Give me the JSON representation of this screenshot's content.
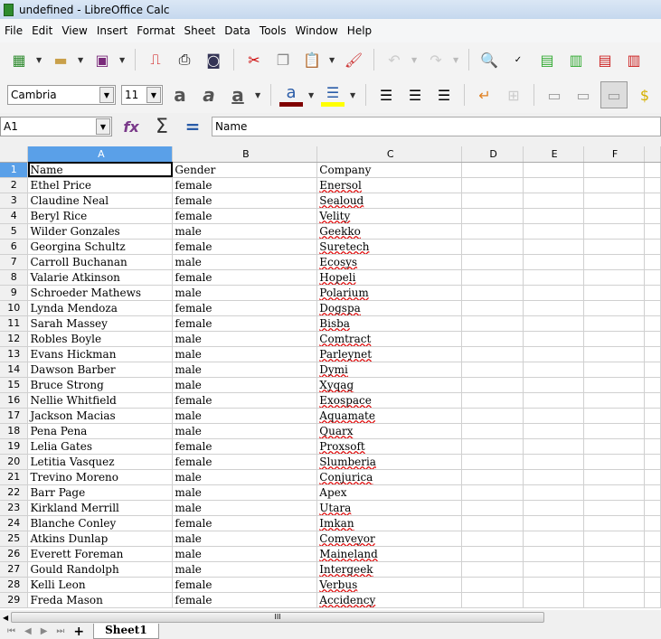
{
  "window": {
    "title": "undefined - LibreOffice Calc"
  },
  "menu": [
    "File",
    "Edit",
    "View",
    "Insert",
    "Format",
    "Sheet",
    "Data",
    "Tools",
    "Window",
    "Help"
  ],
  "font": {
    "name": "Cambria",
    "size": "11"
  },
  "namebox": "A1",
  "formula": "Name",
  "columns": [
    "A",
    "B",
    "C",
    "D",
    "E",
    "F"
  ],
  "header": {
    "name": "Name",
    "gender": "Gender",
    "company": "Company"
  },
  "rows": [
    {
      "name": "Ethel Price",
      "gender": "female",
      "company": "Enersol"
    },
    {
      "name": "Claudine Neal",
      "gender": "female",
      "company": "Sealoud"
    },
    {
      "name": "Beryl Rice",
      "gender": "female",
      "company": "Velity"
    },
    {
      "name": "Wilder Gonzales",
      "gender": "male",
      "company": "Geekko"
    },
    {
      "name": "Georgina Schultz",
      "gender": "female",
      "company": "Suretech"
    },
    {
      "name": "Carroll Buchanan",
      "gender": "male",
      "company": "Ecosys"
    },
    {
      "name": "Valarie Atkinson",
      "gender": "female",
      "company": "Hopeli"
    },
    {
      "name": "Schroeder Mathews",
      "gender": "male",
      "company": "Polarium"
    },
    {
      "name": "Lynda Mendoza",
      "gender": "female",
      "company": "Dogspa"
    },
    {
      "name": "Sarah Massey",
      "gender": "female",
      "company": "Bisba"
    },
    {
      "name": "Robles Boyle",
      "gender": "male",
      "company": "Comtract"
    },
    {
      "name": "Evans Hickman",
      "gender": "male",
      "company": "Parleynet"
    },
    {
      "name": "Dawson Barber",
      "gender": "male",
      "company": "Dymi"
    },
    {
      "name": "Bruce Strong",
      "gender": "male",
      "company": "Xyqag"
    },
    {
      "name": "Nellie Whitfield",
      "gender": "female",
      "company": "Exospace"
    },
    {
      "name": "Jackson Macias",
      "gender": "male",
      "company": "Aquamate"
    },
    {
      "name": "Pena Pena",
      "gender": "male",
      "company": "Quarx"
    },
    {
      "name": "Lelia Gates",
      "gender": "female",
      "company": "Proxsoft"
    },
    {
      "name": "Letitia Vasquez",
      "gender": "female",
      "company": "Slumberia"
    },
    {
      "name": "Trevino Moreno",
      "gender": "male",
      "company": "Conjurica"
    },
    {
      "name": "Barr Page",
      "gender": "male",
      "company": "Apex"
    },
    {
      "name": "Kirkland Merrill",
      "gender": "male",
      "company": "Utara"
    },
    {
      "name": "Blanche Conley",
      "gender": "female",
      "company": "Imkan"
    },
    {
      "name": "Atkins Dunlap",
      "gender": "male",
      "company": "Comveyor"
    },
    {
      "name": "Everett Foreman",
      "gender": "male",
      "company": "Maineland"
    },
    {
      "name": "Gould Randolph",
      "gender": "male",
      "company": "Intergeek"
    },
    {
      "name": "Kelli Leon",
      "gender": "female",
      "company": "Verbus"
    },
    {
      "name": "Freda Mason",
      "gender": "female",
      "company": "Accidency"
    }
  ],
  "sheet_tabs": [
    "Sheet1"
  ],
  "add_sheet": "+",
  "scroll_grip": "III"
}
